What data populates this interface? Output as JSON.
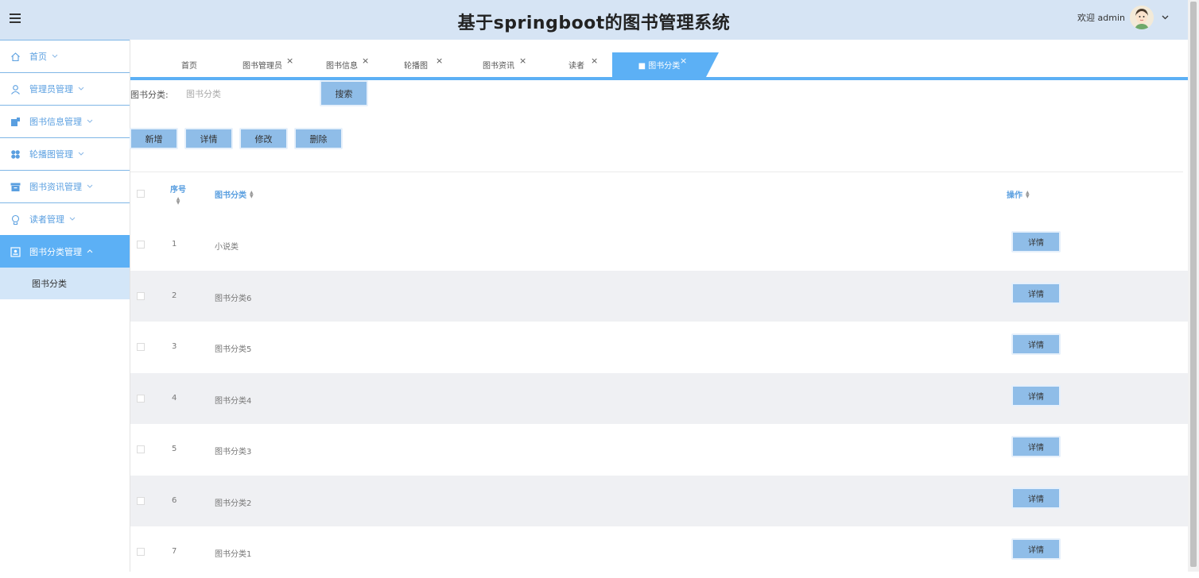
{
  "header": {
    "title": "基于springboot的图书管理系统",
    "welcome": "欢迎 admin"
  },
  "sidebar": {
    "items": [
      {
        "label": "首页",
        "icon": "home-icon"
      },
      {
        "label": "管理员管理",
        "icon": "user-icon"
      },
      {
        "label": "图书信息管理",
        "icon": "book-icon"
      },
      {
        "label": "轮播图管理",
        "icon": "carousel-icon"
      },
      {
        "label": "图书资讯管理",
        "icon": "archive-icon"
      },
      {
        "label": "读者管理",
        "icon": "reader-icon"
      },
      {
        "label": "图书分类管理",
        "icon": "category-icon"
      }
    ],
    "submenu": [
      {
        "label": "图书分类"
      }
    ]
  },
  "tabs": [
    {
      "label": "首页",
      "closable": false
    },
    {
      "label": "图书管理员",
      "closable": true
    },
    {
      "label": "图书信息",
      "closable": true
    },
    {
      "label": "轮播图",
      "closable": true
    },
    {
      "label": "图书资讯",
      "closable": true
    },
    {
      "label": "读者",
      "closable": true
    },
    {
      "label": "■ 图书分类",
      "closable": true,
      "active": true
    }
  ],
  "tab_close_glyph": "×",
  "search": {
    "label": "图书分类:",
    "placeholder": "图书分类",
    "button": "搜索"
  },
  "actions": {
    "add": "新增",
    "detail": "详情",
    "edit": "修改",
    "delete": "删除"
  },
  "table": {
    "columns": {
      "index": "序号",
      "category": "图书分类",
      "operation": "操作"
    },
    "rows": [
      {
        "index": "1",
        "category": "小说类",
        "action": "详情"
      },
      {
        "index": "2",
        "category": "图书分类6",
        "action": "详情"
      },
      {
        "index": "3",
        "category": "图书分类5",
        "action": "详情"
      },
      {
        "index": "4",
        "category": "图书分类4",
        "action": "详情"
      },
      {
        "index": "5",
        "category": "图书分类3",
        "action": "详情"
      },
      {
        "index": "6",
        "category": "图书分类2",
        "action": "详情"
      },
      {
        "index": "7",
        "category": "图书分类1",
        "action": "详情"
      }
    ]
  },
  "colors": {
    "header_bg": "#d6e4f4",
    "accent": "#5cb0f5",
    "button": "#8fbde8",
    "stripe": "#eff0f3"
  }
}
